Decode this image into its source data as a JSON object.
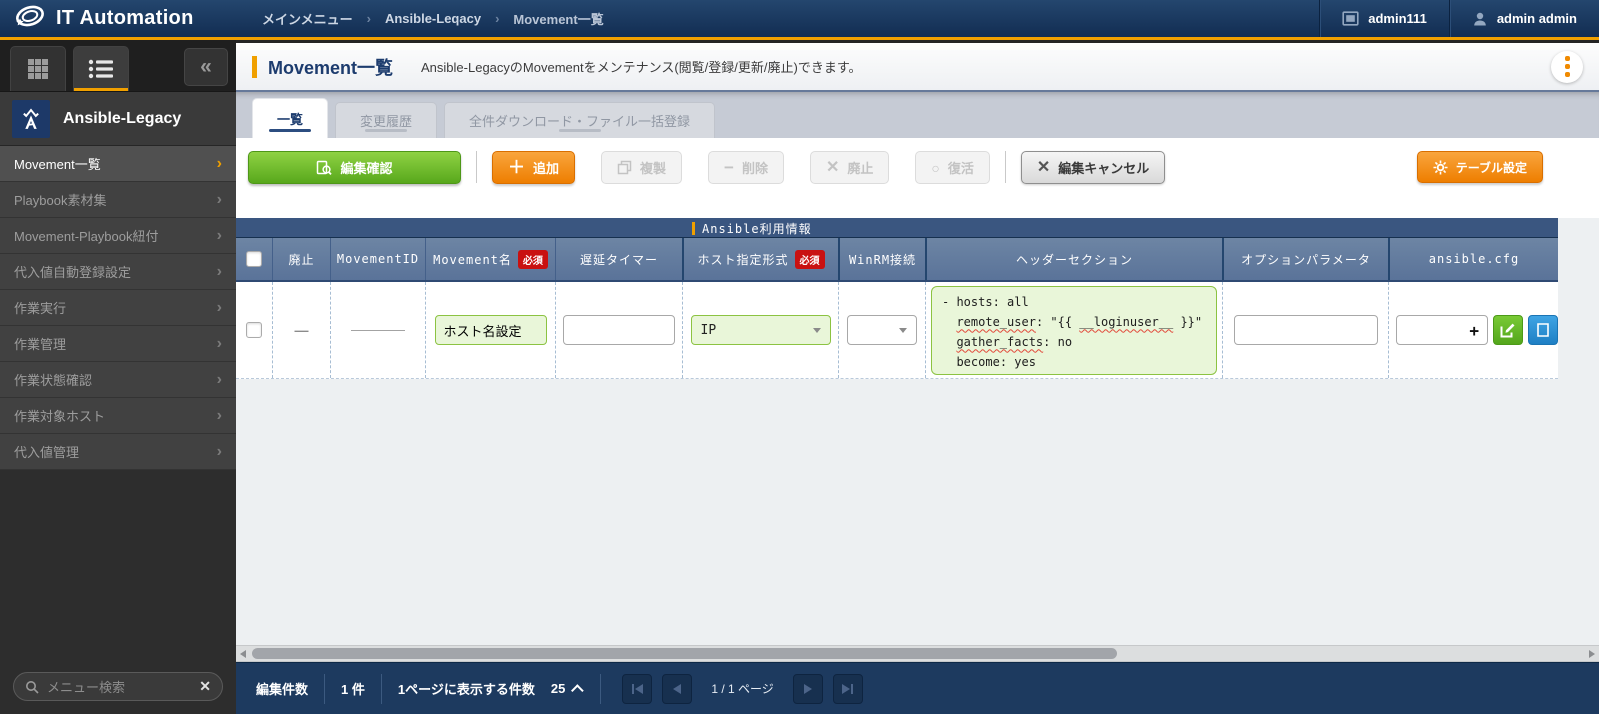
{
  "topbar": {
    "app_title": "IT Automation",
    "breadcrumb": [
      "メインメニュー",
      "Ansible-Leqacy",
      "Movement一覧"
    ],
    "workspace": "admin111",
    "user": "admin admin"
  },
  "sidebar": {
    "brand": "Ansible-Legacy",
    "items": [
      {
        "label": "Movement一覧"
      },
      {
        "label": "Playbook素材集"
      },
      {
        "label": "Movement-Playbook紐付"
      },
      {
        "label": "代入値自動登録設定"
      },
      {
        "label": "作業実行"
      },
      {
        "label": "作業管理"
      },
      {
        "label": "作業状態確認"
      },
      {
        "label": "作業対象ホスト"
      },
      {
        "label": "代入値管理"
      }
    ],
    "search_placeholder": "メニュー検索"
  },
  "page": {
    "title": "Movement一覧",
    "description": "Ansible-LegacyのMovementをメンテナンス(閲覧/登録/更新/廃止)できます。"
  },
  "tabs": {
    "items": [
      "一覧",
      "変更履歴",
      "全件ダウンロード・ファイル一括登録"
    ]
  },
  "toolbar": {
    "edit_confirm": "編集確認",
    "add": "追加",
    "duplicate": "複製",
    "remove": "削除",
    "discard": "廃止",
    "restore": "復活",
    "cancel": "編集キャンセル",
    "table_settings": "テーブル設定"
  },
  "table": {
    "group_label": "Ansible利用情報",
    "required_label": "必須",
    "columns": [
      "廃止",
      "MovementID",
      "Movement名",
      "遅延タイマー",
      "ホスト指定形式",
      "WinRM接続",
      "ヘッダーセクション",
      "オプションパラメータ",
      "ansible.cfg"
    ],
    "row": {
      "discard_mark": "—",
      "movement_name": "ホスト名設定",
      "delay_timer": "",
      "host_format": "IP",
      "winrm": "",
      "option_param": "",
      "ansible_cfg": "",
      "add_file_label": "+",
      "yaml": {
        "l1": "- hosts: all",
        "indent": "  ",
        "l2_key": "remote_user",
        "l2_mid": ": \"{{ ",
        "l2_var": "__loginuser__",
        "l2_end": " }}\"",
        "l3_key": "gather_facts",
        "l3_end": ": no",
        "l4_key": "become",
        "l4_end": ": yes"
      }
    }
  },
  "statusbar": {
    "edit_count_label": "編集件数",
    "edit_count_value": "1 件",
    "per_page_label": "1ページに表示する件数",
    "per_page_value": "25",
    "page_position": "1 / 1 ページ"
  },
  "colors": {
    "accent_orange": "#f0a000",
    "button_green": "#63b424",
    "button_orange": "#ef8200",
    "table_header_blue": "#5d779c",
    "table_group_navy": "#3a5680",
    "required_red": "#c91111",
    "input_green_bg": "#e9f6d9",
    "input_green_border": "#8cc342",
    "topbar_navy": "#16345c"
  }
}
